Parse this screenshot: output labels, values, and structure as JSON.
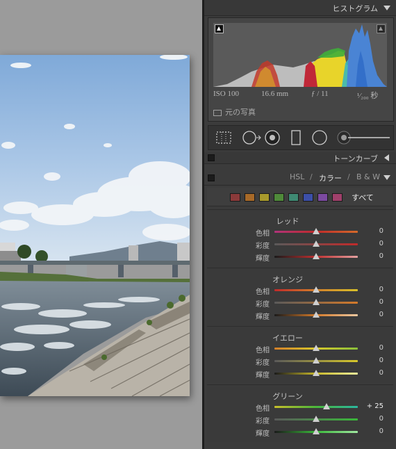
{
  "panel": {
    "histogram_title": "ヒストグラム",
    "tone_curve_title": "トーンカーブ",
    "hsl_tabs": {
      "hsl": "HSL",
      "sep1": "/",
      "color": "カラー",
      "sep2": "/",
      "bw": "B & W"
    },
    "all_label": "すべて"
  },
  "histogram": {
    "iso": "ISO 100",
    "focal": "16.6 mm",
    "aperture": "ƒ / 11",
    "shutter": "¹⁄₂₀₀ 秒",
    "original_photo": "元の写真"
  },
  "swatches": [
    {
      "name": "red",
      "color": "#8b3a3a"
    },
    {
      "name": "orange",
      "color": "#a86a28"
    },
    {
      "name": "yellow",
      "color": "#a89a2c"
    },
    {
      "name": "green",
      "color": "#4f8a3a"
    },
    {
      "name": "aqua",
      "color": "#3f8a73"
    },
    {
      "name": "blue",
      "color": "#3c4fa8"
    },
    {
      "name": "purple",
      "color": "#7b4aa0"
    },
    {
      "name": "magenta",
      "color": "#a0406b"
    }
  ],
  "groups": [
    {
      "name": "レッド",
      "rows": [
        {
          "label": "色相",
          "value": "0",
          "level": 0
        },
        {
          "label": "彩度",
          "value": "0",
          "level": 0
        },
        {
          "label": "輝度",
          "value": "0",
          "level": 0
        }
      ]
    },
    {
      "name": "オレンジ",
      "rows": [
        {
          "label": "色相",
          "value": "0",
          "level": 0
        },
        {
          "label": "彩度",
          "value": "0",
          "level": 0
        },
        {
          "label": "輝度",
          "value": "0",
          "level": 0
        }
      ]
    },
    {
      "name": "イエロー",
      "rows": [
        {
          "label": "色相",
          "value": "0",
          "level": 0
        },
        {
          "label": "彩度",
          "value": "0",
          "level": 0
        },
        {
          "label": "輝度",
          "value": "0",
          "level": 0
        }
      ]
    },
    {
      "name": "グリーン",
      "rows": [
        {
          "label": "色相",
          "value": "+ 25",
          "level": 25
        },
        {
          "label": "彩度",
          "value": "0",
          "level": 0
        },
        {
          "label": "輝度",
          "value": "0",
          "level": 0
        }
      ]
    }
  ]
}
